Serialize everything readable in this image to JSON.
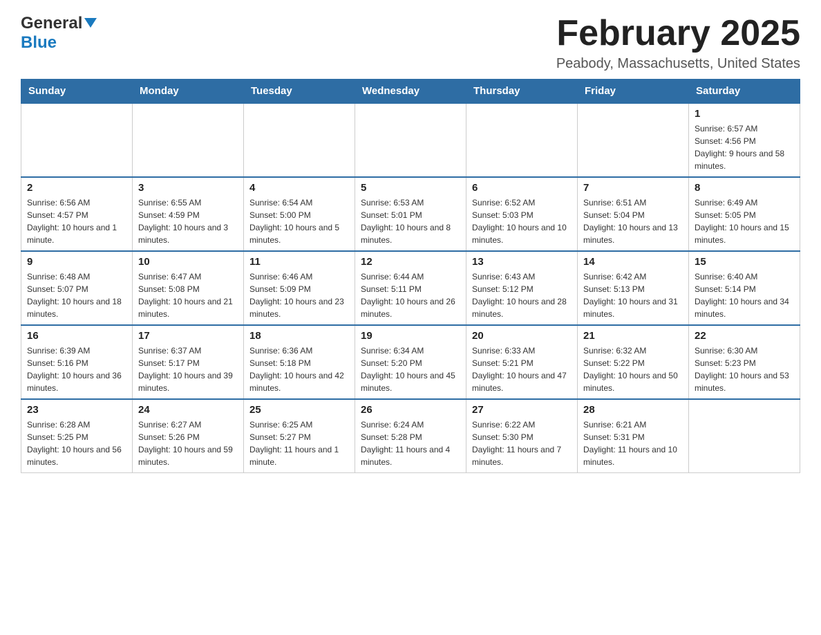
{
  "header": {
    "logo_general": "General",
    "logo_blue": "Blue",
    "month_title": "February 2025",
    "location": "Peabody, Massachusetts, United States"
  },
  "weekdays": [
    "Sunday",
    "Monday",
    "Tuesday",
    "Wednesday",
    "Thursday",
    "Friday",
    "Saturday"
  ],
  "weeks": [
    [
      {
        "day": "",
        "info": ""
      },
      {
        "day": "",
        "info": ""
      },
      {
        "day": "",
        "info": ""
      },
      {
        "day": "",
        "info": ""
      },
      {
        "day": "",
        "info": ""
      },
      {
        "day": "",
        "info": ""
      },
      {
        "day": "1",
        "info": "Sunrise: 6:57 AM\nSunset: 4:56 PM\nDaylight: 9 hours and 58 minutes."
      }
    ],
    [
      {
        "day": "2",
        "info": "Sunrise: 6:56 AM\nSunset: 4:57 PM\nDaylight: 10 hours and 1 minute."
      },
      {
        "day": "3",
        "info": "Sunrise: 6:55 AM\nSunset: 4:59 PM\nDaylight: 10 hours and 3 minutes."
      },
      {
        "day": "4",
        "info": "Sunrise: 6:54 AM\nSunset: 5:00 PM\nDaylight: 10 hours and 5 minutes."
      },
      {
        "day": "5",
        "info": "Sunrise: 6:53 AM\nSunset: 5:01 PM\nDaylight: 10 hours and 8 minutes."
      },
      {
        "day": "6",
        "info": "Sunrise: 6:52 AM\nSunset: 5:03 PM\nDaylight: 10 hours and 10 minutes."
      },
      {
        "day": "7",
        "info": "Sunrise: 6:51 AM\nSunset: 5:04 PM\nDaylight: 10 hours and 13 minutes."
      },
      {
        "day": "8",
        "info": "Sunrise: 6:49 AM\nSunset: 5:05 PM\nDaylight: 10 hours and 15 minutes."
      }
    ],
    [
      {
        "day": "9",
        "info": "Sunrise: 6:48 AM\nSunset: 5:07 PM\nDaylight: 10 hours and 18 minutes."
      },
      {
        "day": "10",
        "info": "Sunrise: 6:47 AM\nSunset: 5:08 PM\nDaylight: 10 hours and 21 minutes."
      },
      {
        "day": "11",
        "info": "Sunrise: 6:46 AM\nSunset: 5:09 PM\nDaylight: 10 hours and 23 minutes."
      },
      {
        "day": "12",
        "info": "Sunrise: 6:44 AM\nSunset: 5:11 PM\nDaylight: 10 hours and 26 minutes."
      },
      {
        "day": "13",
        "info": "Sunrise: 6:43 AM\nSunset: 5:12 PM\nDaylight: 10 hours and 28 minutes."
      },
      {
        "day": "14",
        "info": "Sunrise: 6:42 AM\nSunset: 5:13 PM\nDaylight: 10 hours and 31 minutes."
      },
      {
        "day": "15",
        "info": "Sunrise: 6:40 AM\nSunset: 5:14 PM\nDaylight: 10 hours and 34 minutes."
      }
    ],
    [
      {
        "day": "16",
        "info": "Sunrise: 6:39 AM\nSunset: 5:16 PM\nDaylight: 10 hours and 36 minutes."
      },
      {
        "day": "17",
        "info": "Sunrise: 6:37 AM\nSunset: 5:17 PM\nDaylight: 10 hours and 39 minutes."
      },
      {
        "day": "18",
        "info": "Sunrise: 6:36 AM\nSunset: 5:18 PM\nDaylight: 10 hours and 42 minutes."
      },
      {
        "day": "19",
        "info": "Sunrise: 6:34 AM\nSunset: 5:20 PM\nDaylight: 10 hours and 45 minutes."
      },
      {
        "day": "20",
        "info": "Sunrise: 6:33 AM\nSunset: 5:21 PM\nDaylight: 10 hours and 47 minutes."
      },
      {
        "day": "21",
        "info": "Sunrise: 6:32 AM\nSunset: 5:22 PM\nDaylight: 10 hours and 50 minutes."
      },
      {
        "day": "22",
        "info": "Sunrise: 6:30 AM\nSunset: 5:23 PM\nDaylight: 10 hours and 53 minutes."
      }
    ],
    [
      {
        "day": "23",
        "info": "Sunrise: 6:28 AM\nSunset: 5:25 PM\nDaylight: 10 hours and 56 minutes."
      },
      {
        "day": "24",
        "info": "Sunrise: 6:27 AM\nSunset: 5:26 PM\nDaylight: 10 hours and 59 minutes."
      },
      {
        "day": "25",
        "info": "Sunrise: 6:25 AM\nSunset: 5:27 PM\nDaylight: 11 hours and 1 minute."
      },
      {
        "day": "26",
        "info": "Sunrise: 6:24 AM\nSunset: 5:28 PM\nDaylight: 11 hours and 4 minutes."
      },
      {
        "day": "27",
        "info": "Sunrise: 6:22 AM\nSunset: 5:30 PM\nDaylight: 11 hours and 7 minutes."
      },
      {
        "day": "28",
        "info": "Sunrise: 6:21 AM\nSunset: 5:31 PM\nDaylight: 11 hours and 10 minutes."
      },
      {
        "day": "",
        "info": ""
      }
    ]
  ]
}
